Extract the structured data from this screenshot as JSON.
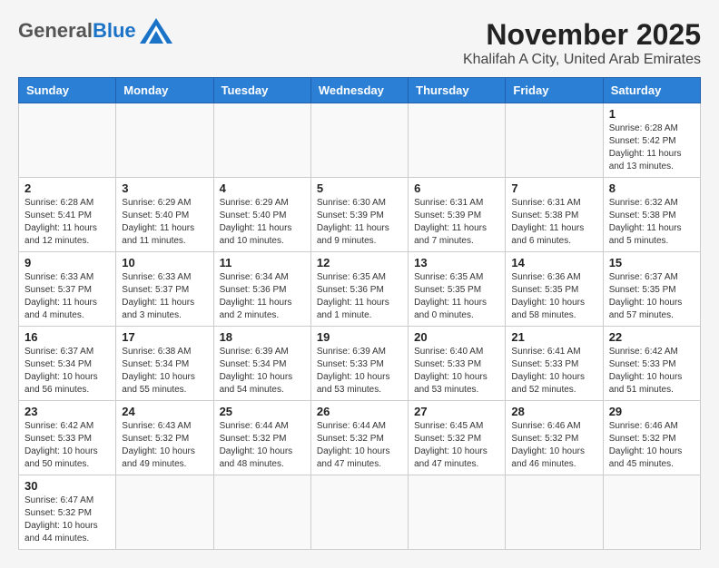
{
  "logo": {
    "general": "General",
    "blue": "Blue"
  },
  "title": {
    "month_year": "November 2025",
    "location": "Khalifah A City, United Arab Emirates"
  },
  "days_of_week": [
    "Sunday",
    "Monday",
    "Tuesday",
    "Wednesday",
    "Thursday",
    "Friday",
    "Saturday"
  ],
  "weeks": [
    [
      {
        "day": "",
        "info": ""
      },
      {
        "day": "",
        "info": ""
      },
      {
        "day": "",
        "info": ""
      },
      {
        "day": "",
        "info": ""
      },
      {
        "day": "",
        "info": ""
      },
      {
        "day": "",
        "info": ""
      },
      {
        "day": "1",
        "info": "Sunrise: 6:28 AM\nSunset: 5:42 PM\nDaylight: 11 hours and 13 minutes."
      }
    ],
    [
      {
        "day": "2",
        "info": "Sunrise: 6:28 AM\nSunset: 5:41 PM\nDaylight: 11 hours and 12 minutes."
      },
      {
        "day": "3",
        "info": "Sunrise: 6:29 AM\nSunset: 5:40 PM\nDaylight: 11 hours and 11 minutes."
      },
      {
        "day": "4",
        "info": "Sunrise: 6:29 AM\nSunset: 5:40 PM\nDaylight: 11 hours and 10 minutes."
      },
      {
        "day": "5",
        "info": "Sunrise: 6:30 AM\nSunset: 5:39 PM\nDaylight: 11 hours and 9 minutes."
      },
      {
        "day": "6",
        "info": "Sunrise: 6:31 AM\nSunset: 5:39 PM\nDaylight: 11 hours and 7 minutes."
      },
      {
        "day": "7",
        "info": "Sunrise: 6:31 AM\nSunset: 5:38 PM\nDaylight: 11 hours and 6 minutes."
      },
      {
        "day": "8",
        "info": "Sunrise: 6:32 AM\nSunset: 5:38 PM\nDaylight: 11 hours and 5 minutes."
      }
    ],
    [
      {
        "day": "9",
        "info": "Sunrise: 6:33 AM\nSunset: 5:37 PM\nDaylight: 11 hours and 4 minutes."
      },
      {
        "day": "10",
        "info": "Sunrise: 6:33 AM\nSunset: 5:37 PM\nDaylight: 11 hours and 3 minutes."
      },
      {
        "day": "11",
        "info": "Sunrise: 6:34 AM\nSunset: 5:36 PM\nDaylight: 11 hours and 2 minutes."
      },
      {
        "day": "12",
        "info": "Sunrise: 6:35 AM\nSunset: 5:36 PM\nDaylight: 11 hours and 1 minute."
      },
      {
        "day": "13",
        "info": "Sunrise: 6:35 AM\nSunset: 5:35 PM\nDaylight: 11 hours and 0 minutes."
      },
      {
        "day": "14",
        "info": "Sunrise: 6:36 AM\nSunset: 5:35 PM\nDaylight: 10 hours and 58 minutes."
      },
      {
        "day": "15",
        "info": "Sunrise: 6:37 AM\nSunset: 5:35 PM\nDaylight: 10 hours and 57 minutes."
      }
    ],
    [
      {
        "day": "16",
        "info": "Sunrise: 6:37 AM\nSunset: 5:34 PM\nDaylight: 10 hours and 56 minutes."
      },
      {
        "day": "17",
        "info": "Sunrise: 6:38 AM\nSunset: 5:34 PM\nDaylight: 10 hours and 55 minutes."
      },
      {
        "day": "18",
        "info": "Sunrise: 6:39 AM\nSunset: 5:34 PM\nDaylight: 10 hours and 54 minutes."
      },
      {
        "day": "19",
        "info": "Sunrise: 6:39 AM\nSunset: 5:33 PM\nDaylight: 10 hours and 53 minutes."
      },
      {
        "day": "20",
        "info": "Sunrise: 6:40 AM\nSunset: 5:33 PM\nDaylight: 10 hours and 53 minutes."
      },
      {
        "day": "21",
        "info": "Sunrise: 6:41 AM\nSunset: 5:33 PM\nDaylight: 10 hours and 52 minutes."
      },
      {
        "day": "22",
        "info": "Sunrise: 6:42 AM\nSunset: 5:33 PM\nDaylight: 10 hours and 51 minutes."
      }
    ],
    [
      {
        "day": "23",
        "info": "Sunrise: 6:42 AM\nSunset: 5:33 PM\nDaylight: 10 hours and 50 minutes."
      },
      {
        "day": "24",
        "info": "Sunrise: 6:43 AM\nSunset: 5:32 PM\nDaylight: 10 hours and 49 minutes."
      },
      {
        "day": "25",
        "info": "Sunrise: 6:44 AM\nSunset: 5:32 PM\nDaylight: 10 hours and 48 minutes."
      },
      {
        "day": "26",
        "info": "Sunrise: 6:44 AM\nSunset: 5:32 PM\nDaylight: 10 hours and 47 minutes."
      },
      {
        "day": "27",
        "info": "Sunrise: 6:45 AM\nSunset: 5:32 PM\nDaylight: 10 hours and 47 minutes."
      },
      {
        "day": "28",
        "info": "Sunrise: 6:46 AM\nSunset: 5:32 PM\nDaylight: 10 hours and 46 minutes."
      },
      {
        "day": "29",
        "info": "Sunrise: 6:46 AM\nSunset: 5:32 PM\nDaylight: 10 hours and 45 minutes."
      }
    ],
    [
      {
        "day": "30",
        "info": "Sunrise: 6:47 AM\nSunset: 5:32 PM\nDaylight: 10 hours and 44 minutes."
      },
      {
        "day": "",
        "info": ""
      },
      {
        "day": "",
        "info": ""
      },
      {
        "day": "",
        "info": ""
      },
      {
        "day": "",
        "info": ""
      },
      {
        "day": "",
        "info": ""
      },
      {
        "day": "",
        "info": ""
      }
    ]
  ]
}
